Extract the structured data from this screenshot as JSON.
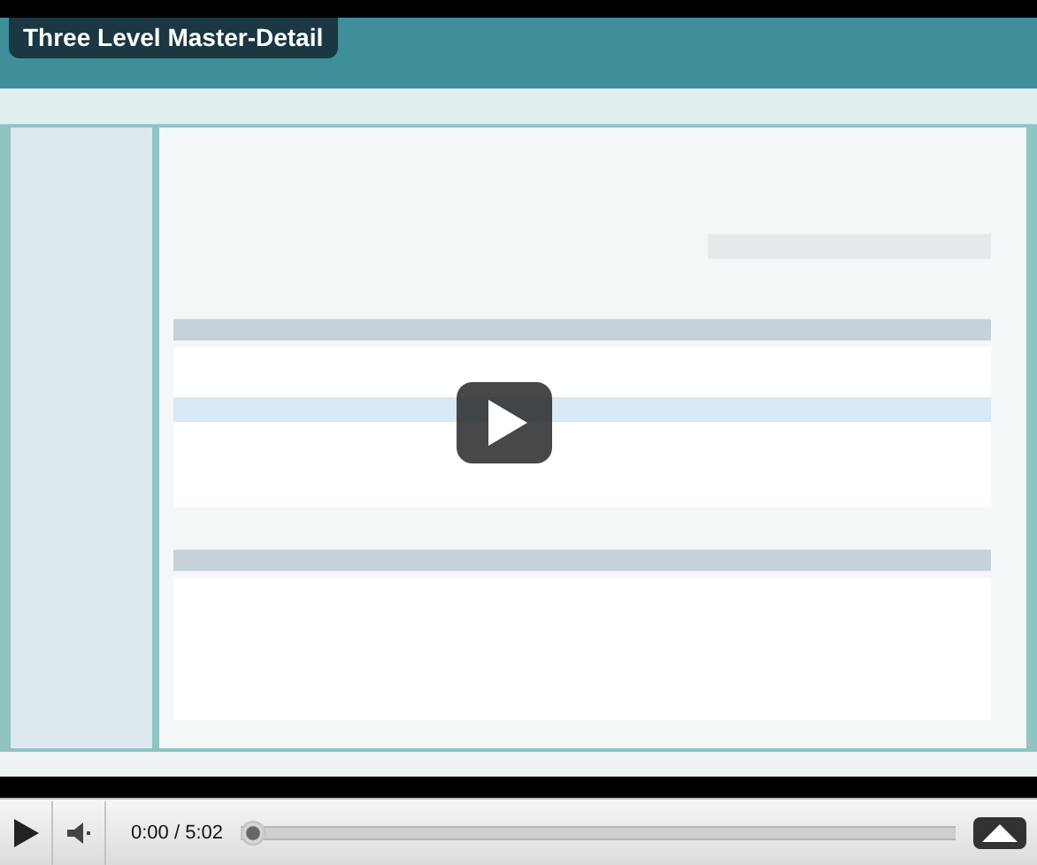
{
  "video": {
    "kind": "picture",
    "title": "Three Level Master-Detail"
  },
  "controls": {
    "time": "0:00 / 5:02",
    "progress": {
      "level": 0
    }
  }
}
